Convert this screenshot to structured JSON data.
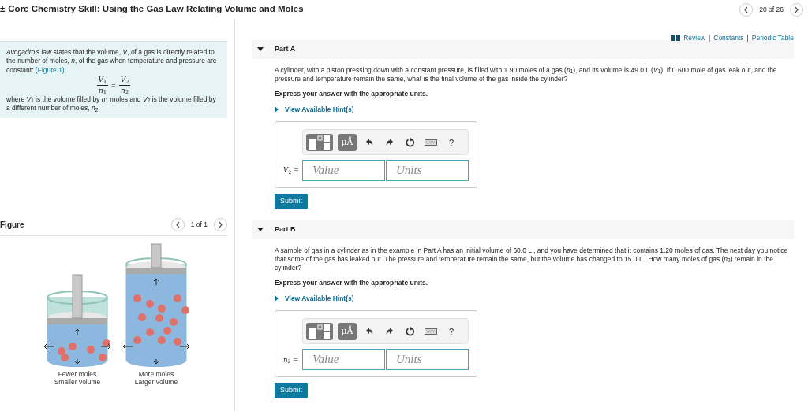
{
  "header": {
    "title_icon": "±",
    "title": "Core Chemistry Skill: Using the Gas Law Relating Volume and Moles",
    "pager": "20 of 26"
  },
  "intro": {
    "text": "*Avogadro's law* states that the volume, *V*, of a gas is directly related to the number of moles, *n*, of the gas when temperature and pressure are constant: ",
    "link": "(Figure 1)",
    "equation": {
      "left_num": "*V*$_{1}$",
      "left_den": "*n*$_{1}$",
      "op": "=",
      "right_num": "*V*$_{2}$",
      "right_den": "*n*$_{2}$"
    },
    "after": "where *V*$_{1}$ is the volume filled by *n*$_{1}$ moles and *V*$_{2}$ is the volume filled by a different number of moles, *n*$_{2}$."
  },
  "figure": {
    "title": "Figure",
    "pager": "1 of 1",
    "panels": [
      {
        "kind": "few",
        "caption": [
          "Fewer moles",
          "Smaller volume"
        ]
      },
      {
        "kind": "more",
        "caption": [
          "More moles",
          "Larger volume"
        ]
      }
    ]
  },
  "links": [
    {
      "kind": "link",
      "text": "Review"
    },
    {
      "kind": "separator",
      "text": "|"
    },
    {
      "kind": "link",
      "text": "Constants"
    },
    {
      "kind": "separator",
      "text": "|"
    },
    {
      "kind": "link",
      "text": "Periodic Table"
    }
  ],
  "parts": [
    {
      "title": "Part A",
      "expanded": true,
      "text": "A cylinder, with a piston pressing down with a constant pressure, is filled with 1.90 moles of a gas (*n*$_{1}$), and its volume is 49.0 L (*V*$_{1}$). If 0.600 mole of gas leak out, and the pressure and temperature remain the same, what is the final volume of the gas inside the cylinder?",
      "instruction": "Express your answer with the appropriate units.",
      "hint": "View Available Hint(s)",
      "answer_label": "*V*$_{2}$ =",
      "value_placeholder": "Value",
      "units_placeholder": "Units",
      "submit": "Submit",
      "toolbar": [
        {
          "kind": "template"
        },
        {
          "kind": "units",
          "label": "μÅ"
        },
        {
          "kind": "undo"
        },
        {
          "kind": "redo"
        },
        {
          "kind": "reset"
        },
        {
          "kind": "keyboard"
        },
        {
          "kind": "help",
          "label": "?"
        }
      ]
    },
    {
      "title": "Part B",
      "expanded": true,
      "text": "A sample of gas in a cylinder as in the example in Part A has an initial volume of 60.0 L , and you have determined that it contains 1.20 moles of gas. The next day you notice that some of the gas has leaked out. The pressure and temperature remain the same, but the volume has changed to 15.0 L . How many moles of gas (*n*$_{2}$) remain in the cylinder?",
      "instruction": "Express your answer with the appropriate units.",
      "hint": "View Available Hint(s)",
      "answer_label": "*n*$_{2}$ =",
      "value_placeholder": "Value",
      "units_placeholder": "Units",
      "submit": "Submit",
      "toolbar": [
        {
          "kind": "template"
        },
        {
          "kind": "units",
          "label": "μÅ"
        },
        {
          "kind": "undo"
        },
        {
          "kind": "redo"
        },
        {
          "kind": "reset"
        },
        {
          "kind": "keyboard"
        },
        {
          "kind": "help",
          "label": "?"
        }
      ]
    }
  ]
}
